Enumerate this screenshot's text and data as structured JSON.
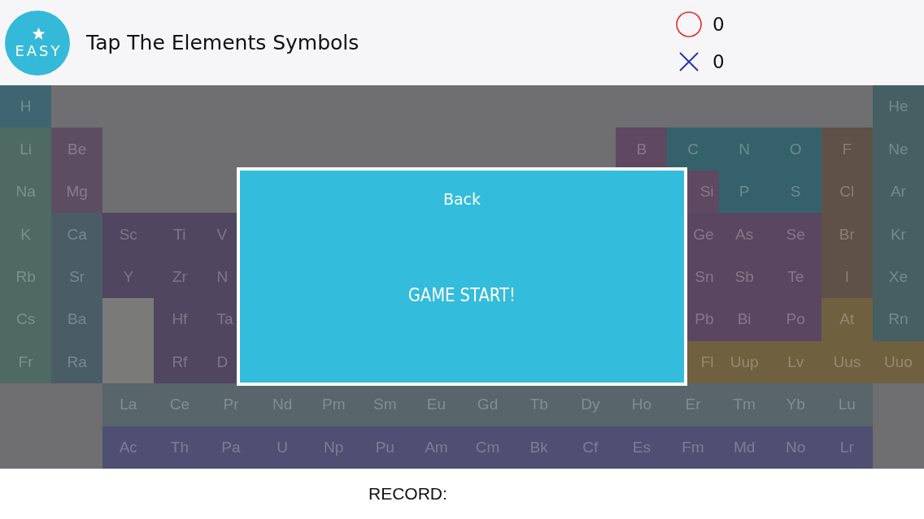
{
  "header": {
    "badge": {
      "label": "EASY"
    },
    "title": "Tap The Elements Symbols",
    "scores": [
      {
        "kind": "correct",
        "value": "0"
      },
      {
        "kind": "wrong",
        "value": "0"
      }
    ]
  },
  "table": {
    "rows": [
      [
        {
          "symbol": "H",
          "color": "#3f6670",
          "kind": "full"
        },
        null,
        null,
        null,
        null,
        null,
        null,
        null,
        null,
        null,
        null,
        null,
        null,
        null,
        null,
        null,
        null,
        {
          "symbol": "He",
          "color": "#455f63",
          "kind": "full"
        }
      ],
      [
        {
          "symbol": "Li",
          "color": "#4e6a63",
          "kind": "full"
        },
        {
          "symbol": "Be",
          "color": "#5d4d63",
          "kind": "full"
        },
        null,
        null,
        null,
        null,
        null,
        null,
        null,
        null,
        null,
        null,
        {
          "symbol": "B",
          "color": "#5e4862",
          "kind": "full"
        },
        {
          "symbol": "C",
          "color": "#35626a",
          "kind": "full"
        },
        {
          "symbol": "N",
          "color": "#35626a",
          "kind": "full"
        },
        {
          "symbol": "O",
          "color": "#35626a",
          "kind": "full"
        },
        {
          "symbol": "F",
          "color": "#5f5048",
          "kind": "full"
        },
        {
          "symbol": "Ne",
          "color": "#455f63",
          "kind": "full"
        }
      ],
      [
        {
          "symbol": "Na",
          "color": "#4e6a63",
          "kind": "full"
        },
        {
          "symbol": "Mg",
          "color": "#5d4d63",
          "kind": "full"
        },
        null,
        null,
        null,
        null,
        null,
        null,
        null,
        null,
        null,
        null,
        null,
        {
          "symbol": "Si",
          "color": "#5e4862",
          "kind": "cut-left"
        },
        {
          "symbol": "P",
          "color": "#35626a",
          "kind": "full"
        },
        {
          "symbol": "S",
          "color": "#35626a",
          "kind": "full"
        },
        {
          "symbol": "Cl",
          "color": "#5f5048",
          "kind": "full"
        },
        {
          "symbol": "Ar",
          "color": "#455f63",
          "kind": "full"
        }
      ],
      [
        {
          "symbol": "K",
          "color": "#4e6a63",
          "kind": "full"
        },
        {
          "symbol": "Ca",
          "color": "#4a5c66",
          "kind": "full"
        },
        {
          "symbol": "Sc",
          "color": "#50465f",
          "kind": "full"
        },
        {
          "symbol": "Ti",
          "color": "#50465f",
          "kind": "full"
        },
        {
          "symbol": "V",
          "color": "#50465f",
          "kind": "cut-right"
        },
        null,
        null,
        null,
        null,
        null,
        null,
        null,
        null,
        {
          "symbol": "Ge",
          "color": "#5a4660",
          "kind": "cut-left"
        },
        {
          "symbol": "As",
          "color": "#5a4660",
          "kind": "full"
        },
        {
          "symbol": "Se",
          "color": "#5a4660",
          "kind": "full"
        },
        {
          "symbol": "Br",
          "color": "#5f5048",
          "kind": "full"
        },
        {
          "symbol": "Kr",
          "color": "#455f63",
          "kind": "full"
        }
      ],
      [
        {
          "symbol": "Rb",
          "color": "#4e6a63",
          "kind": "full"
        },
        {
          "symbol": "Sr",
          "color": "#4a5c66",
          "kind": "full"
        },
        {
          "symbol": "Y",
          "color": "#50465f",
          "kind": "full"
        },
        {
          "symbol": "Zr",
          "color": "#50465f",
          "kind": "full"
        },
        {
          "symbol": "N",
          "color": "#50465f",
          "kind": "cut-right"
        },
        null,
        null,
        null,
        null,
        null,
        null,
        null,
        null,
        {
          "symbol": "Sn",
          "color": "#5a4660",
          "kind": "cut-left"
        },
        {
          "symbol": "Sb",
          "color": "#5a4660",
          "kind": "full"
        },
        {
          "symbol": "Te",
          "color": "#5a4660",
          "kind": "full"
        },
        {
          "symbol": "I",
          "color": "#5f5048",
          "kind": "full"
        },
        {
          "symbol": "Xe",
          "color": "#455f63",
          "kind": "full"
        }
      ],
      [
        {
          "symbol": "Cs",
          "color": "#4e6a63",
          "kind": "full"
        },
        {
          "symbol": "Ba",
          "color": "#4a5c66",
          "kind": "full"
        },
        {
          "color": "#7a7a78",
          "kind": "slot"
        },
        {
          "symbol": "Hf",
          "color": "#50465f",
          "kind": "full"
        },
        {
          "symbol": "Ta",
          "color": "#50465f",
          "kind": "cut-right"
        },
        null,
        null,
        null,
        null,
        null,
        null,
        null,
        null,
        {
          "symbol": "Pb",
          "color": "#5a4660",
          "kind": "cut-left"
        },
        {
          "symbol": "Bi",
          "color": "#5a4660",
          "kind": "full"
        },
        {
          "symbol": "Po",
          "color": "#5a4660",
          "kind": "full"
        },
        {
          "symbol": "At",
          "color": "#6f6040",
          "kind": "full"
        },
        {
          "symbol": "Rn",
          "color": "#455f63",
          "kind": "full"
        }
      ],
      [
        {
          "symbol": "Fr",
          "color": "#4e6a63",
          "kind": "full"
        },
        {
          "symbol": "Ra",
          "color": "#4a5c66",
          "kind": "full"
        },
        {
          "color": "#7a7a78",
          "kind": "slot"
        },
        {
          "symbol": "Rf",
          "color": "#50465f",
          "kind": "full"
        },
        {
          "symbol": "D",
          "color": "#50465f",
          "kind": "cut-right"
        },
        null,
        null,
        null,
        null,
        null,
        null,
        null,
        null,
        {
          "symbol": "Fl",
          "color": "#6f6040",
          "kind": "cut-left"
        },
        {
          "symbol": "Uup",
          "color": "#6f6040",
          "kind": "full"
        },
        {
          "symbol": "Lv",
          "color": "#6f6040",
          "kind": "full"
        },
        {
          "symbol": "Uus",
          "color": "#6f6040",
          "kind": "full"
        },
        {
          "symbol": "Uuo",
          "color": "#6f6040",
          "kind": "full"
        }
      ],
      [
        null,
        null,
        {
          "symbol": "La",
          "color": "#58656a",
          "kind": "full"
        },
        {
          "symbol": "Ce",
          "color": "#58656a",
          "kind": "full"
        },
        {
          "symbol": "Pr",
          "color": "#58656a",
          "kind": "full"
        },
        {
          "symbol": "Nd",
          "color": "#58656a",
          "kind": "full"
        },
        {
          "symbol": "Pm",
          "color": "#58656a",
          "kind": "full"
        },
        {
          "symbol": "Sm",
          "color": "#58656a",
          "kind": "full"
        },
        {
          "symbol": "Eu",
          "color": "#58656a",
          "kind": "full"
        },
        {
          "symbol": "Gd",
          "color": "#58656a",
          "kind": "full"
        },
        {
          "symbol": "Tb",
          "color": "#58656a",
          "kind": "full"
        },
        {
          "symbol": "Dy",
          "color": "#58656a",
          "kind": "full"
        },
        {
          "symbol": "Ho",
          "color": "#58656a",
          "kind": "full"
        },
        {
          "symbol": "Er",
          "color": "#58656a",
          "kind": "full"
        },
        {
          "symbol": "Tm",
          "color": "#58656a",
          "kind": "full"
        },
        {
          "symbol": "Yb",
          "color": "#58656a",
          "kind": "full"
        },
        {
          "symbol": "Lu",
          "color": "#58656a",
          "kind": "full"
        },
        null
      ],
      [
        null,
        null,
        {
          "symbol": "Ac",
          "color": "#4e4f72",
          "kind": "full"
        },
        {
          "symbol": "Th",
          "color": "#4e4f72",
          "kind": "full"
        },
        {
          "symbol": "Pa",
          "color": "#4e4f72",
          "kind": "full"
        },
        {
          "symbol": "U",
          "color": "#4e4f72",
          "kind": "full"
        },
        {
          "symbol": "Np",
          "color": "#4e4f72",
          "kind": "full"
        },
        {
          "symbol": "Pu",
          "color": "#4e4f72",
          "kind": "full"
        },
        {
          "symbol": "Am",
          "color": "#4e4f72",
          "kind": "full"
        },
        {
          "symbol": "Cm",
          "color": "#4e4f72",
          "kind": "full"
        },
        {
          "symbol": "Bk",
          "color": "#4e4f72",
          "kind": "full"
        },
        {
          "symbol": "Cf",
          "color": "#4e4f72",
          "kind": "full"
        },
        {
          "symbol": "Es",
          "color": "#4e4f72",
          "kind": "full"
        },
        {
          "symbol": "Fm",
          "color": "#4e4f72",
          "kind": "full"
        },
        {
          "symbol": "Md",
          "color": "#4e4f72",
          "kind": "full"
        },
        {
          "symbol": "No",
          "color": "#4e4f72",
          "kind": "full"
        },
        {
          "symbol": "Lr",
          "color": "#4e4f72",
          "kind": "full"
        },
        null
      ]
    ]
  },
  "dialog": {
    "back_button": "Back",
    "message": "GAME START!"
  },
  "footer": {
    "record": "RECORD:"
  }
}
